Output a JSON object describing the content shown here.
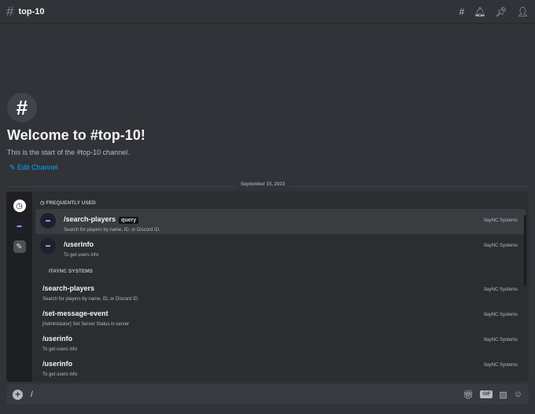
{
  "header": {
    "channel": "top-10"
  },
  "welcome": {
    "icon": "#",
    "title": "Welcome to #top-10!",
    "subtitle": "This is the start of the #top-10 channel.",
    "edit": "Edit Channel"
  },
  "divider": {
    "date": "September 15, 2023"
  },
  "popup": {
    "frequent_label": "FREQUENTLY USED",
    "frequent": [
      {
        "command": "/search-players",
        "option": "query",
        "description": "Search for players by name, ID, or Discord ID.",
        "source": "ItayNC Systems"
      },
      {
        "command": "/userinfo",
        "description": "To get users info",
        "source": "ItayNC Systems"
      }
    ],
    "app_label": "ITAYNC SYSTEMS",
    "app": [
      {
        "command": "/search-players",
        "description": "Search for players by name, ID, or Discord ID.",
        "source": "ItayNC Systems"
      },
      {
        "command": "/set-message-event",
        "description": "[Administator] Set Server Status in server",
        "source": "ItayNC Systems"
      },
      {
        "command": "/userinfo",
        "description": "To get users info",
        "source": "ItayNC Systems"
      },
      {
        "command": "/userinfo",
        "description": "To get users info",
        "source": "ItayNC Systems"
      }
    ]
  },
  "input": {
    "value": "/",
    "gif": "GIF"
  }
}
